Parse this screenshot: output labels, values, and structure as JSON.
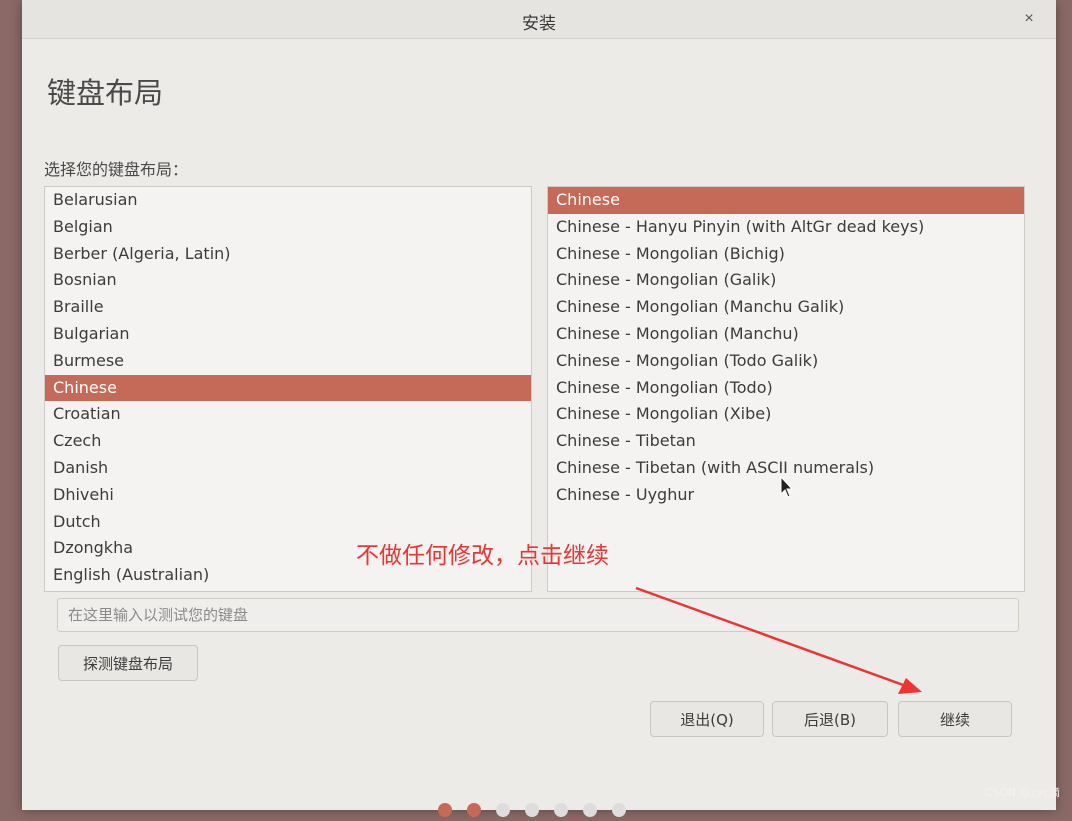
{
  "window": {
    "title": "安装",
    "close_glyph": "×"
  },
  "page": {
    "title": "键盘布局",
    "prompt": "选择您的键盘布局："
  },
  "layouts": {
    "items": [
      {
        "label": "Belarusian",
        "selected": false
      },
      {
        "label": "Belgian",
        "selected": false
      },
      {
        "label": "Berber (Algeria, Latin)",
        "selected": false
      },
      {
        "label": "Bosnian",
        "selected": false
      },
      {
        "label": "Braille",
        "selected": false
      },
      {
        "label": "Bulgarian",
        "selected": false
      },
      {
        "label": "Burmese",
        "selected": false
      },
      {
        "label": "Chinese",
        "selected": true
      },
      {
        "label": "Croatian",
        "selected": false
      },
      {
        "label": "Czech",
        "selected": false
      },
      {
        "label": "Danish",
        "selected": false
      },
      {
        "label": "Dhivehi",
        "selected": false
      },
      {
        "label": "Dutch",
        "selected": false
      },
      {
        "label": "Dzongkha",
        "selected": false
      },
      {
        "label": "English (Australian)",
        "selected": false
      }
    ]
  },
  "variants": {
    "items": [
      {
        "label": "Chinese",
        "selected": true
      },
      {
        "label": "Chinese - Hanyu Pinyin (with AltGr dead keys)",
        "selected": false
      },
      {
        "label": "Chinese - Mongolian (Bichig)",
        "selected": false
      },
      {
        "label": "Chinese - Mongolian (Galik)",
        "selected": false
      },
      {
        "label": "Chinese - Mongolian (Manchu Galik)",
        "selected": false
      },
      {
        "label": "Chinese - Mongolian (Manchu)",
        "selected": false
      },
      {
        "label": "Chinese - Mongolian (Todo Galik)",
        "selected": false
      },
      {
        "label": "Chinese - Mongolian (Todo)",
        "selected": false
      },
      {
        "label": "Chinese - Mongolian (Xibe)",
        "selected": false
      },
      {
        "label": "Chinese - Tibetan",
        "selected": false
      },
      {
        "label": "Chinese - Tibetan (with ASCII numerals)",
        "selected": false
      },
      {
        "label": "Chinese - Uyghur",
        "selected": false
      }
    ]
  },
  "test_input": {
    "placeholder": "在这里输入以测试您的键盘",
    "value": ""
  },
  "buttons": {
    "detect": "探测键盘布局",
    "quit": "退出(Q)",
    "back": "后退(B)",
    "continue": "继续"
  },
  "annotation": {
    "text": "不做任何修改，点击继续",
    "color": "#ee3333"
  },
  "watermark": "CSDN @zyc滴",
  "colors": {
    "selection": "#c56a59",
    "window_bg": "#ecebe8"
  },
  "icons": {
    "close": "close-icon",
    "cursor": "mouse-pointer-icon"
  }
}
